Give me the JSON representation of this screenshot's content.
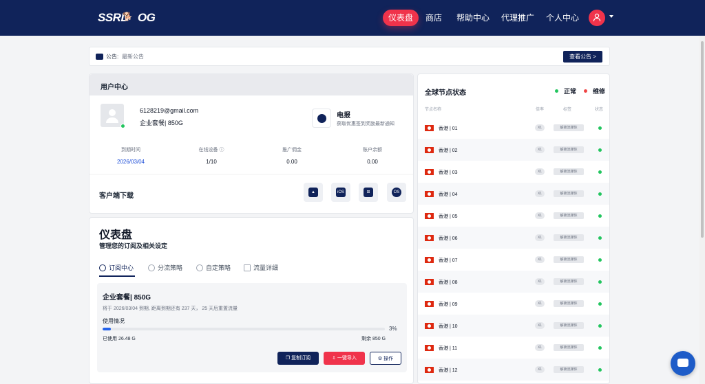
{
  "brand": {
    "logo_text": "SSRDOG",
    "accent": "#f0334b",
    "navy": "#10235a"
  },
  "nav": [
    {
      "label": "仪表盘",
      "active": true
    },
    {
      "label": "商店"
    },
    {
      "label": "帮助中心"
    },
    {
      "label": "代理推广"
    },
    {
      "label": "个人中心"
    }
  ],
  "notice": {
    "prefix": "公告:",
    "text": "最新公告",
    "button": "查看公告 >"
  },
  "user_center": {
    "title": "用户中心",
    "email": "6128219@gmail.com",
    "plan": "企业套餐| 850G",
    "telegram": {
      "title": "电报",
      "subtitle": "获取优惠签到奖励最新通知"
    },
    "stats": [
      {
        "label": "到期时间",
        "value": "2026/03/04"
      },
      {
        "label": "在线设备 ⓘ",
        "value": "1/10"
      },
      {
        "label": "推广佣金",
        "value": "0.00"
      },
      {
        "label": "账户余额",
        "value": "0.00"
      }
    ],
    "download_label": "客户端下载",
    "download_icons": [
      "android-icon",
      "ios-icon",
      "windows-icon",
      "macos-icon"
    ],
    "ios_text": "iOS",
    "mac_text": "OS"
  },
  "dashboard": {
    "title": "仪表盘",
    "subtitle": "管理您的订阅及相关设定",
    "tabs": [
      {
        "label": "订阅中心",
        "active": true
      },
      {
        "label": "分流策略"
      },
      {
        "label": "自定策略"
      },
      {
        "label": "流量详细"
      }
    ],
    "subscription": {
      "title": "企业套餐| 850G",
      "desc": "将于 2026/03/04 到期, 距离到期还有 237 天， 25 天后重置流量",
      "usage_label": "使用情况",
      "percent": 3,
      "percent_text": "3%",
      "used": "已使用 26.48 G",
      "remain": "剩余 850 G",
      "buttons": [
        "复制订阅",
        "一键导入",
        "操作"
      ]
    }
  },
  "nodes": {
    "title": "全球节点状态",
    "legend": [
      {
        "label": "正常",
        "color": "#22c55e"
      },
      {
        "label": "维修",
        "color": "#ef4444"
      }
    ],
    "headers": [
      "节点名称",
      "倍率",
      "标签",
      "状态"
    ],
    "rows": [
      {
        "name": "香港 | 01",
        "rate": "X1",
        "tag": "解锁流媒体"
      },
      {
        "name": "香港 | 02",
        "rate": "X1",
        "tag": "解锁流媒体"
      },
      {
        "name": "香港 | 03",
        "rate": "X1",
        "tag": "解锁流媒体"
      },
      {
        "name": "香港 | 04",
        "rate": "X1",
        "tag": "解锁流媒体"
      },
      {
        "name": "香港 | 05",
        "rate": "X1",
        "tag": "解锁流媒体"
      },
      {
        "name": "香港 | 06",
        "rate": "X1",
        "tag": "解锁流媒体"
      },
      {
        "name": "香港 | 07",
        "rate": "X1",
        "tag": "解锁流媒体"
      },
      {
        "name": "香港 | 08",
        "rate": "X1",
        "tag": "解锁流媒体"
      },
      {
        "name": "香港 | 09",
        "rate": "X1",
        "tag": "解锁流媒体"
      },
      {
        "name": "香港 | 10",
        "rate": "X1",
        "tag": "解锁流媒体"
      },
      {
        "name": "香港 | 11",
        "rate": "X1",
        "tag": "解锁流媒体"
      },
      {
        "name": "香港 | 12",
        "rate": "X1",
        "tag": "解锁流媒体"
      }
    ]
  }
}
